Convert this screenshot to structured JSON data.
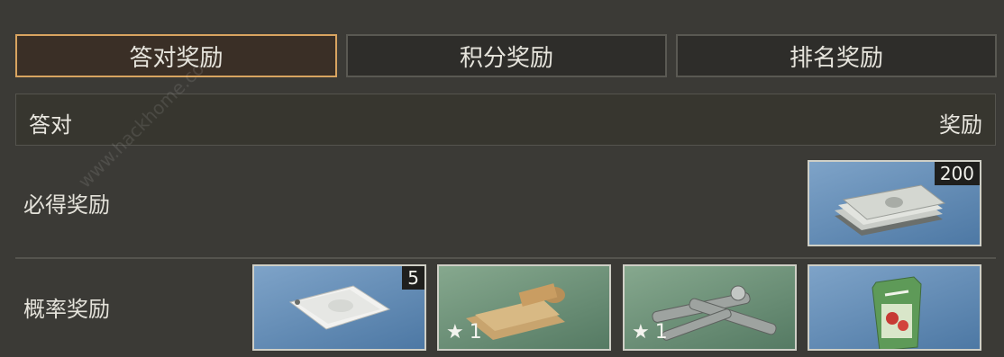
{
  "tabs": [
    {
      "label": "答对奖励",
      "active": true
    },
    {
      "label": "积分奖励",
      "active": false
    },
    {
      "label": "排名奖励",
      "active": false
    }
  ],
  "header": {
    "left": "答对",
    "right": "奖励"
  },
  "rows": {
    "guaranteed_label": "必得奖励",
    "chance_label": "概率奖励"
  },
  "rewards": {
    "guaranteed": [
      {
        "icon": "cash-stack-icon",
        "count": "200"
      }
    ],
    "chance": [
      {
        "icon": "sealed-bag-icon",
        "count": "5"
      },
      {
        "icon": "cloth-roll-icon",
        "stars": "1"
      },
      {
        "icon": "metal-pipes-icon",
        "stars": "1"
      },
      {
        "icon": "seed-packet-icon"
      }
    ]
  },
  "watermark": "www.hackhome.com"
}
